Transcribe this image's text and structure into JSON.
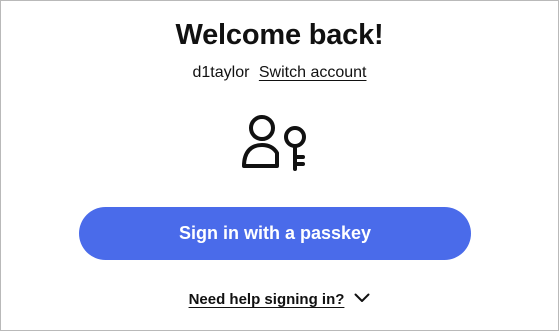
{
  "header": {
    "title": "Welcome back!"
  },
  "account": {
    "username": "d1taylor",
    "switch_label": "Switch account"
  },
  "passkey": {
    "icon": "user-key-icon",
    "button_label": "Sign in with a passkey",
    "button_color": "#4a6bea"
  },
  "help": {
    "label": "Need help signing in?",
    "icon": "chevron-down-icon"
  }
}
